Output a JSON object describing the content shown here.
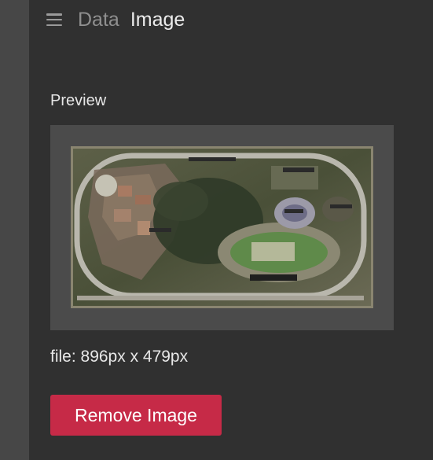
{
  "header": {
    "menu_icon": "hamburger-menu-icon",
    "breadcrumb": "Data",
    "title": "Image"
  },
  "preview": {
    "label": "Preview",
    "image_content": "aerial-satellite-photo"
  },
  "file_info": "file: 896px x 479px",
  "remove_button_label": "Remove Image",
  "colors": {
    "background": "#303030",
    "side_strip": "#474747",
    "preview_box": "#4b4b4b",
    "remove_button": "#c62a47"
  }
}
